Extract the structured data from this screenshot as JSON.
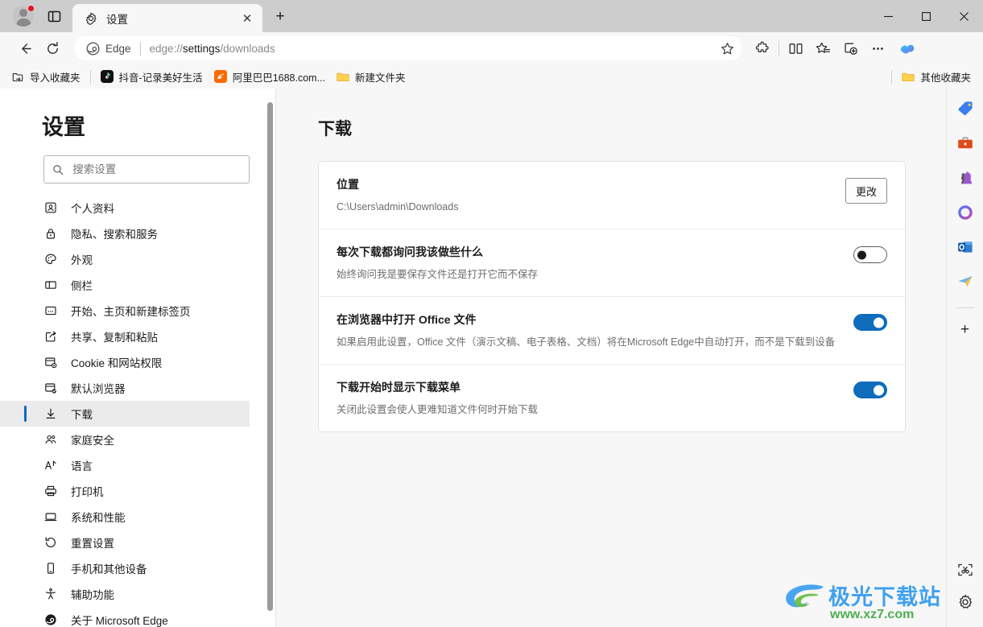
{
  "window": {
    "minimize_label": "—",
    "maximize_label": "□",
    "close_label": "✕"
  },
  "tabstrip": {
    "profile_name": "profile-avatar",
    "tab_actions_label": "标签页操作菜单",
    "tabs": [
      {
        "title": "设置",
        "favicon": "gear-icon",
        "close_label": "✕"
      }
    ],
    "new_tab_label": "+"
  },
  "toolbar": {
    "back_label": "←",
    "refresh_label": "⟳",
    "omnibox": {
      "brand": "Edge",
      "url_prefix": "edge://",
      "url_bold": "settings",
      "url_suffix": "/downloads",
      "full_url": "edge://settings/downloads",
      "star_label": "☆"
    },
    "buttons": [
      {
        "name": "extensions-icon",
        "label": "扩展"
      },
      {
        "name": "split-screen-icon",
        "label": "拆分屏幕"
      },
      {
        "name": "favorites-icon",
        "label": "收藏夹"
      },
      {
        "name": "collections-icon",
        "label": "集锦"
      },
      {
        "name": "more-options-icon",
        "label": "设置及其他"
      }
    ],
    "copilot_label": "Copilot"
  },
  "bookmarks": {
    "import_label": "导入收藏夹",
    "items": [
      {
        "label": "抖音-记录美好生活",
        "icon": "tiktok-icon"
      },
      {
        "label": "阿里巴巴1688.com...",
        "icon": "alibaba-icon"
      },
      {
        "label": "新建文件夹",
        "icon": "folder-icon"
      }
    ],
    "other_favorites": "其他收藏夹"
  },
  "settings": {
    "title": "设置",
    "search_placeholder": "搜索设置",
    "search_value": "",
    "nav_items": [
      {
        "label": "个人资料",
        "icon": "profile-icon",
        "active": false
      },
      {
        "label": "隐私、搜索和服务",
        "icon": "lock-icon",
        "active": false
      },
      {
        "label": "外观",
        "icon": "palette-icon",
        "active": false
      },
      {
        "label": "侧栏",
        "icon": "sidebar-icon",
        "active": false
      },
      {
        "label": "开始、主页和新建标签页",
        "icon": "home-icon",
        "active": false
      },
      {
        "label": "共享、复制和粘贴",
        "icon": "share-icon",
        "active": false
      },
      {
        "label": "Cookie 和网站权限",
        "icon": "cookie-icon",
        "active": false
      },
      {
        "label": "默认浏览器",
        "icon": "default-browser-icon",
        "active": false
      },
      {
        "label": "下载",
        "icon": "download-icon",
        "active": true
      },
      {
        "label": "家庭安全",
        "icon": "family-icon",
        "active": false
      },
      {
        "label": "语言",
        "icon": "language-icon",
        "active": false
      },
      {
        "label": "打印机",
        "icon": "printer-icon",
        "active": false
      },
      {
        "label": "系统和性能",
        "icon": "system-icon",
        "active": false
      },
      {
        "label": "重置设置",
        "icon": "reset-icon",
        "active": false
      },
      {
        "label": "手机和其他设备",
        "icon": "phone-icon",
        "active": false
      },
      {
        "label": "辅助功能",
        "icon": "accessibility-icon",
        "active": false
      },
      {
        "label": "关于 Microsoft Edge",
        "icon": "edge-icon",
        "active": false
      }
    ]
  },
  "main": {
    "heading": "下载",
    "rows": [
      {
        "title": "位置",
        "subtitle": "C:\\Users\\admin\\Downloads",
        "control": "button",
        "button_label": "更改"
      },
      {
        "title": "每次下载都询问我该做些什么",
        "subtitle": "始终询问我是要保存文件还是打开它而不保存",
        "control": "toggle",
        "toggle_on": false
      },
      {
        "title": "在浏览器中打开 Office 文件",
        "subtitle": "如果启用此设置，Office 文件（演示文稿、电子表格、文档）将在Microsoft Edge中自动打开，而不是下载到设备",
        "control": "toggle",
        "toggle_on": true
      },
      {
        "title": "下载开始时显示下载菜单",
        "subtitle": "关闭此设置会使人更难知道文件何时开始下载",
        "control": "toggle",
        "toggle_on": true
      }
    ]
  },
  "edge_sidebar": {
    "apps": [
      {
        "name": "shopping-tag-icon",
        "label": "购物"
      },
      {
        "name": "tools-icon",
        "label": "工具"
      },
      {
        "name": "games-icon",
        "label": "游戏"
      },
      {
        "name": "microsoft365-icon",
        "label": "Microsoft 365"
      },
      {
        "name": "outlook-icon",
        "label": "Outlook"
      },
      {
        "name": "send-icon",
        "label": "投递"
      }
    ],
    "add_label": "+",
    "bottom": [
      {
        "name": "screenshot-icon",
        "label": "网页捕获"
      },
      {
        "name": "settings-gear-icon",
        "label": "侧栏设置"
      }
    ]
  },
  "watermark": {
    "text": "极光下载站",
    "url": "www.xz7.com"
  },
  "colors": {
    "accent": "#0f6cbd",
    "titlebar": "#cdcdcd",
    "toolbar": "#f7f7f7",
    "content_bg": "#f7f7f7",
    "card_bg": "#ffffff",
    "active_nav_bg": "#ebebeb",
    "notification_dot": "#e81123"
  }
}
